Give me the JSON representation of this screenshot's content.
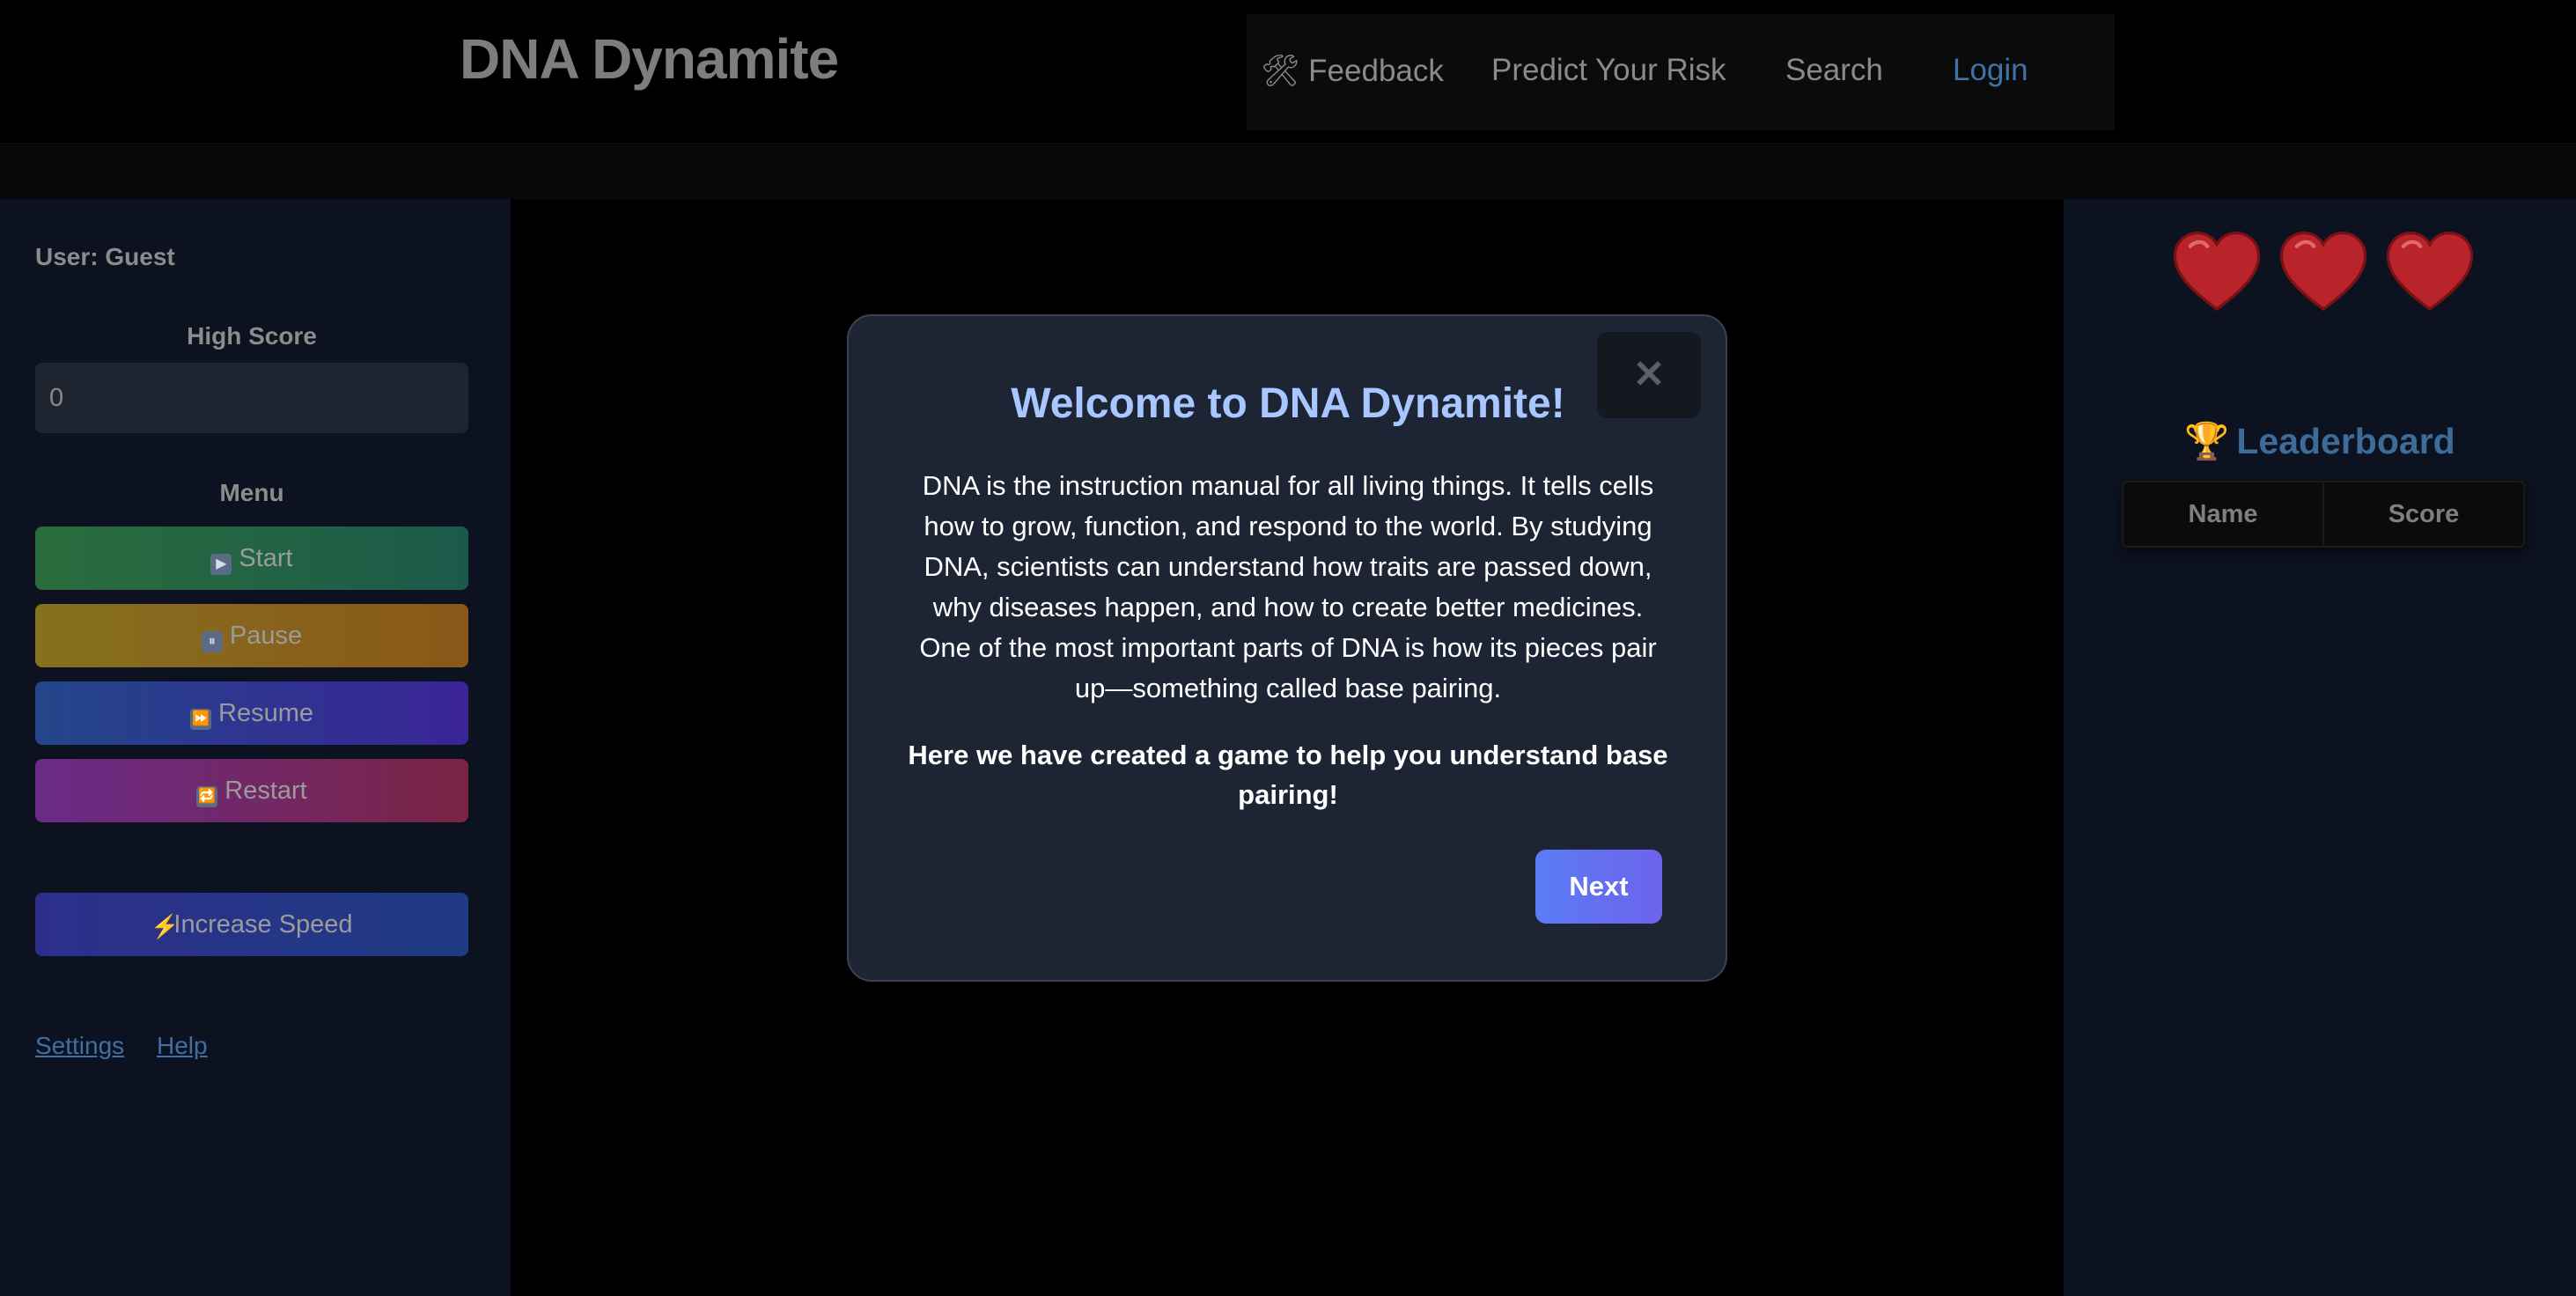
{
  "header": {
    "brand": "DNA Dynamite",
    "nav": {
      "feedback_icon": "🛠",
      "feedback": "Feedback",
      "predict": "Predict Your Risk",
      "search": "Search",
      "login": "Login"
    }
  },
  "left_panel": {
    "user": "User: Guest",
    "high_score_title": "High Score",
    "high_score_value": "0",
    "menu_title": "Menu",
    "buttons": {
      "start": "Start",
      "pause": "Pause",
      "resume": "Resume",
      "restart": "Restart",
      "speed": "Increase Speed"
    },
    "button_icons": {
      "start": "▶",
      "pause": "⏸",
      "resume": "⏩",
      "restart": "🔁",
      "speed": "⚡"
    },
    "links": {
      "settings": "Settings",
      "help": "Help"
    }
  },
  "right_panel": {
    "lives": 3,
    "leaderboard_icon": "🏆",
    "leaderboard_title": "Leaderboard",
    "columns": [
      "Name",
      "Score"
    ]
  },
  "modal": {
    "close": "✕",
    "title": "Welcome to DNA Dynamite!",
    "body": "DNA is the instruction manual for all living things. It tells cells how to grow, function, and respond to the world. By studying DNA, scientists can understand how traits are passed down, why diseases happen, and how to create better medicines. One of the most important parts of DNA is how its pieces pair up—something called base pairing.",
    "strong": "Here we have created a game to help you understand base pairing!",
    "next": "Next"
  },
  "colors": {
    "accent": "#5b7cf5",
    "heart": "#c0282a",
    "modal_bg": "#1d2534",
    "sidebar_bg": "#0c1220"
  }
}
